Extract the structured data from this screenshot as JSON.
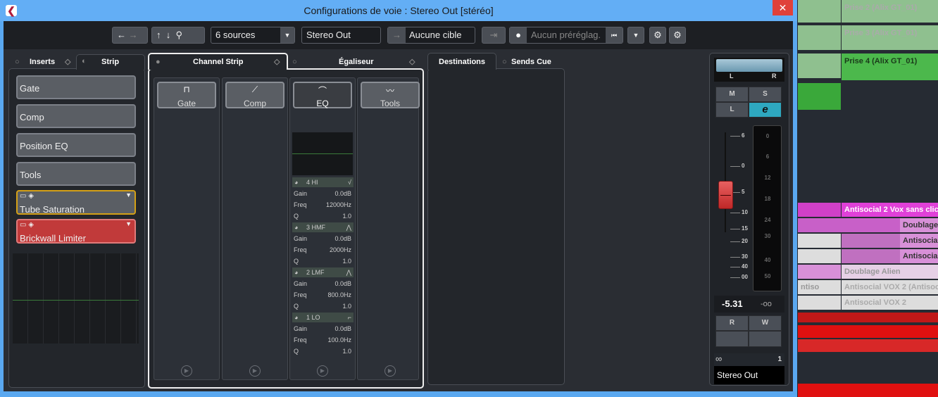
{
  "window": {
    "title": "Configurations de voie : Stereo Out [stéréo]",
    "close": "✕"
  },
  "toolbar": {
    "sources": "6 sources",
    "channel": "Stereo Out",
    "target": "Aucune cible",
    "preset_placeholder": "Aucun préréglag."
  },
  "left": {
    "tab_inserts": "Inserts",
    "tab_strip": "Strip",
    "slots": [
      "Gate",
      "Comp",
      "Position EQ",
      "Tools",
      "Tube Saturation",
      "Brickwall Limiter"
    ]
  },
  "center": {
    "tab_channel_strip": "Channel Strip",
    "tab_eq": "Égaliseur",
    "modules": [
      "Gate",
      "Comp",
      "EQ",
      "Tools"
    ],
    "bands": [
      {
        "name": "4 HI",
        "gain": "0.0dB",
        "freq": "12000Hz",
        "q": "1.0"
      },
      {
        "name": "3 HMF",
        "gain": "0.0dB",
        "freq": "2000Hz",
        "q": "1.0"
      },
      {
        "name": "2 LMF",
        "gain": "0.0dB",
        "freq": "800.0Hz",
        "q": "1.0"
      },
      {
        "name": "1 LO",
        "gain": "0.0dB",
        "freq": "100.0Hz",
        "q": "1.0"
      }
    ],
    "labels": {
      "gain": "Gain",
      "freq": "Freq",
      "q": "Q"
    }
  },
  "sends": {
    "tab_destinations": "Destinations",
    "tab_sends_cue": "Sends Cue"
  },
  "channel": {
    "pan_l": "L",
    "pan_r": "R",
    "mute": "M",
    "solo": "S",
    "listen": "L",
    "edit": "e",
    "fader_scale": [
      "6",
      "0",
      "5",
      "10",
      "15",
      "20",
      "30",
      "40",
      "00"
    ],
    "meter_scale": [
      "0",
      "6",
      "12",
      "18",
      "24",
      "30",
      "40",
      "50"
    ],
    "volume": "-5.31",
    "peak": "-oo",
    "read": "R",
    "write": "W",
    "number": "1",
    "name": "Stereo Out",
    "fader_db": -5.31
  },
  "arrange": {
    "clips": [
      "Prise 2 (Alix GT_01)",
      "Prise 3 (Alix GT_01)",
      "Prise 4 (Alix GT_01)",
      "Antisocial 2 Vox sans clic (",
      "Doublage",
      "Antisocial",
      "Antisocial",
      "Doublage Alien",
      "Antisocial VOX 2 (Antisoci",
      "Antisocial VOX 2",
      "ntiso"
    ]
  }
}
